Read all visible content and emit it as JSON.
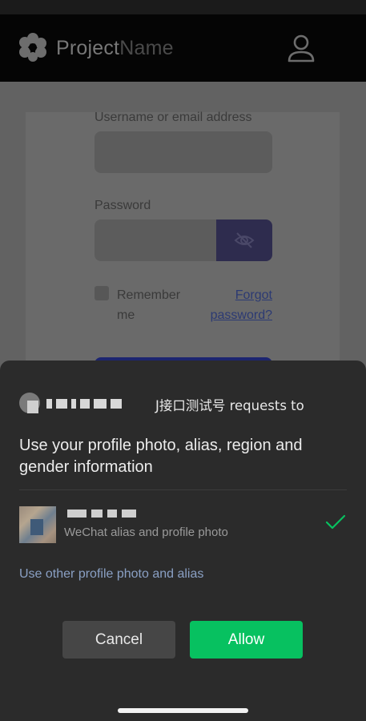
{
  "website": {
    "brand": {
      "name_primary": "Project",
      "name_secondary": "Name"
    },
    "login": {
      "username_label": "Username or email address",
      "password_label": "Password",
      "remember_label": "Remember me",
      "forgot_label": "Forgot password?"
    }
  },
  "auth_sheet": {
    "app_request": "J接口测试号 requests to",
    "title": "Use your profile photo, alias, region and gender information",
    "profile_description": "WeChat alias and profile photo",
    "other_link": "Use other profile photo and alias",
    "cancel_label": "Cancel",
    "allow_label": "Allow"
  },
  "colors": {
    "allow_green": "#07c160",
    "link_blue": "#8aa0c4",
    "sheet_bg": "#2b2b2b"
  },
  "icons": [
    "logo-icon",
    "user-icon",
    "eye-slash-icon",
    "checkmark-icon"
  ]
}
